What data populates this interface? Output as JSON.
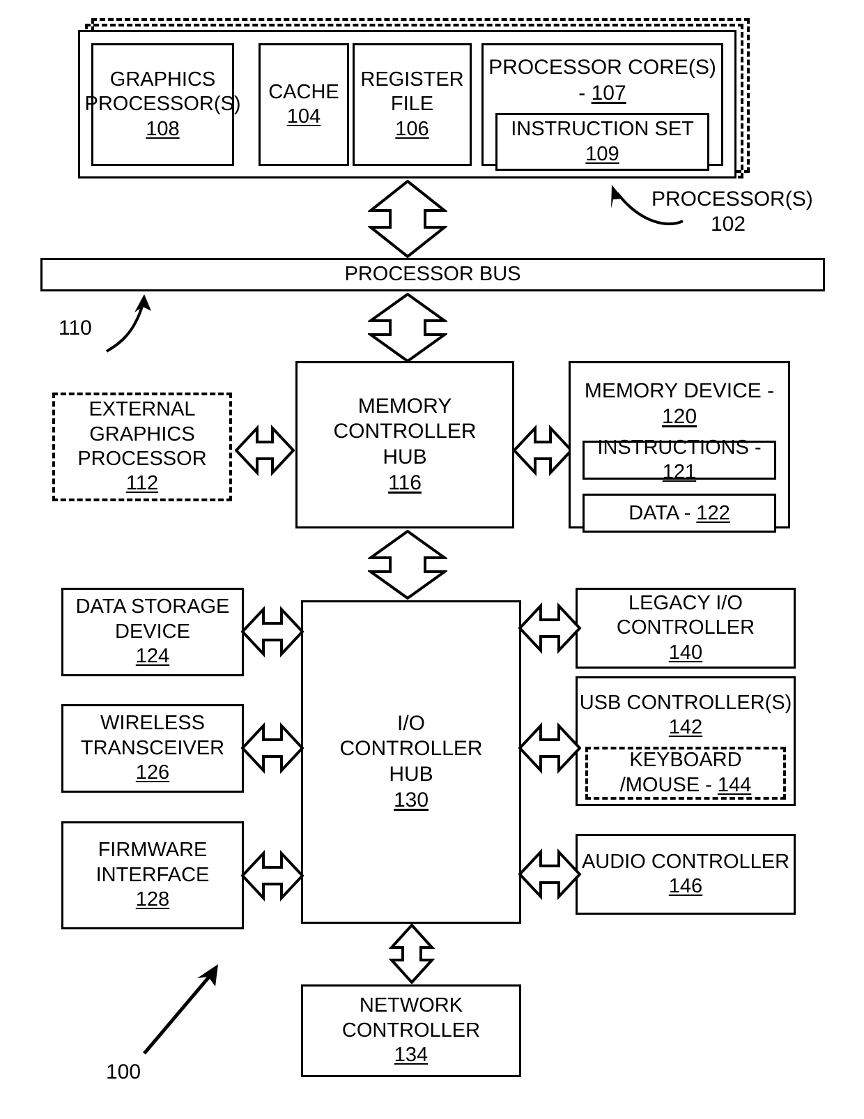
{
  "figure": {
    "id": "100",
    "processor_group": {
      "callout_label": "PROCESSOR(S)",
      "callout_number": "102",
      "blocks": [
        {
          "name": "graphics-processor",
          "title": "GRAPHICS\nPROCESSOR(S)",
          "number": "108"
        },
        {
          "name": "cache",
          "title": "CACHE",
          "number": "104"
        },
        {
          "name": "register-file",
          "title": "REGISTER\nFILE",
          "number": "106"
        },
        {
          "name": "processor-cores",
          "title": "PROCESSOR CORE(S) - ",
          "number": "107",
          "child": {
            "name": "instruction-set",
            "title": "INSTRUCTION SET",
            "number": "109"
          }
        }
      ]
    },
    "processor_bus": {
      "label": "PROCESSOR BUS",
      "number": "110"
    },
    "memory_controller_hub": {
      "title": "MEMORY\nCONTROLLER\nHUB",
      "number": "116"
    },
    "external_graphics_processor": {
      "title": "EXTERNAL\nGRAPHICS\nPROCESSOR",
      "number": "112"
    },
    "memory_device": {
      "title": "MEMORY DEVICE - ",
      "number": "120",
      "children": [
        {
          "name": "instructions",
          "title": "INSTRUCTIONS - ",
          "number": "121"
        },
        {
          "name": "data",
          "title": "DATA - ",
          "number": "122"
        }
      ]
    },
    "io_controller_hub": {
      "title": "I/O\nCONTROLLER\nHUB",
      "number": "130"
    },
    "left_peripherals": [
      {
        "name": "data-storage-device",
        "title": "DATA STORAGE\nDEVICE",
        "number": "124"
      },
      {
        "name": "wireless-transceiver",
        "title": "WIRELESS\nTRANSCEIVER",
        "number": "126"
      },
      {
        "name": "firmware-interface",
        "title": "FIRMWARE\nINTERFACE",
        "number": "128"
      }
    ],
    "right_peripherals": [
      {
        "name": "legacy-io-controller",
        "title": "LEGACY I/O\nCONTROLLER",
        "number": "140"
      },
      {
        "name": "usb-controller",
        "title": "USB CONTROLLER(S)",
        "number": "142",
        "child": {
          "name": "keyboard-mouse",
          "title": "KEYBOARD\n/MOUSE - ",
          "number": "144"
        }
      },
      {
        "name": "audio-controller",
        "title": "AUDIO CONTROLLER",
        "number": "146"
      }
    ],
    "network_controller": {
      "title": "NETWORK\nCONTROLLER",
      "number": "134"
    },
    "colors": {
      "stroke": "#000000",
      "background": "#ffffff"
    }
  }
}
